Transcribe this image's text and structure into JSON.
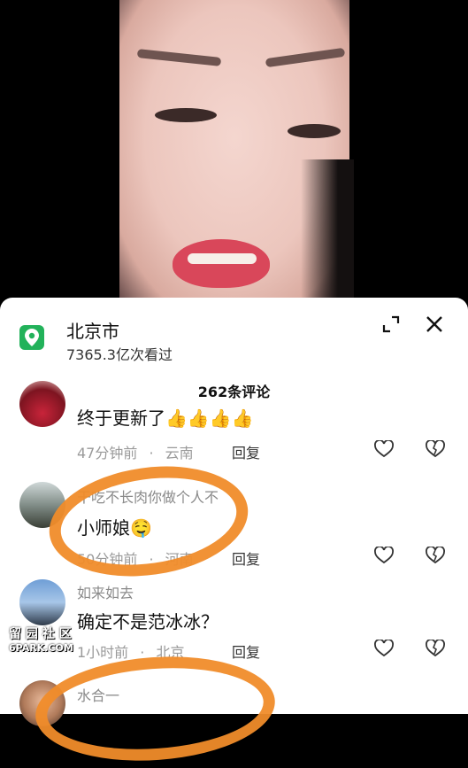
{
  "location": {
    "title": "北京市",
    "views": "7365.3亿次看过"
  },
  "comment_count": "262条评论",
  "comments": [
    {
      "user": "",
      "text": "终于更新了",
      "emoji": "👍👍👍👍",
      "time": "47分钟前",
      "region": "云南",
      "reply": "回复"
    },
    {
      "user": "干吃不长肉你做个人不",
      "text": "小师娘",
      "emoji": "🤤",
      "time": "50分钟前",
      "region": "河南",
      "reply": "回复"
    },
    {
      "user": "如来如去",
      "text": "确定不是范冰冰？",
      "emoji": "",
      "time": "1小时前",
      "region": "北京",
      "reply": "回复"
    },
    {
      "user": "水合一",
      "text": "",
      "emoji": "",
      "time": "",
      "region": "",
      "reply": ""
    }
  ],
  "separator": "·",
  "watermark": {
    "line1": "留 园 社 区",
    "line2": "6PARK.COM"
  },
  "colors": {
    "accent_green": "#22b25a",
    "annotation_orange": "#f08c2a"
  }
}
